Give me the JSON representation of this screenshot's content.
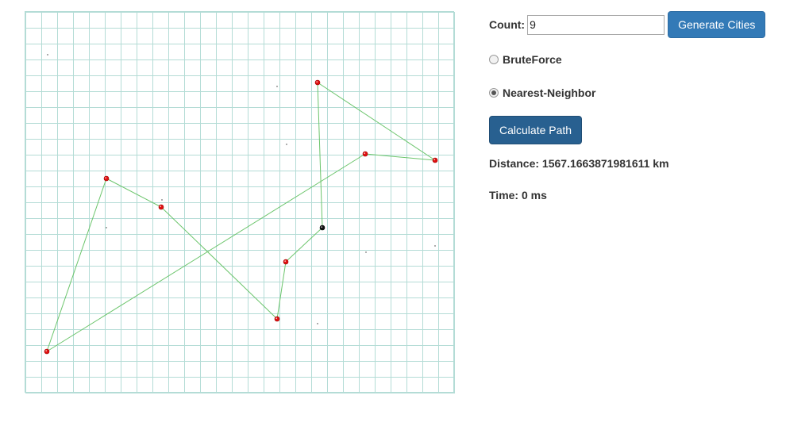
{
  "controls": {
    "count_label": "Count:",
    "count_value": "9",
    "generate_label": "Generate Cities",
    "algorithms": [
      {
        "label": "BruteForce",
        "selected": false
      },
      {
        "label": "Nearest-Neighbor",
        "selected": true
      }
    ],
    "calculate_label": "Calculate Path"
  },
  "results": {
    "distance_label": "Distance:",
    "distance_value": "1567.1663871981611",
    "distance_unit": "km",
    "time_label": "Time:",
    "time_value": "0",
    "time_unit": "ms"
  },
  "map": {
    "colors": {
      "grid": "#b4dcd6",
      "path": "#6cc56c",
      "city": "#e01010",
      "start_city": "#111111"
    },
    "cities": [
      {
        "id": "start",
        "start": true
      },
      {
        "id": "c1"
      },
      {
        "id": "c2"
      },
      {
        "id": "c3"
      },
      {
        "id": "c4"
      },
      {
        "id": "c5"
      },
      {
        "id": "c6"
      },
      {
        "id": "c7"
      },
      {
        "id": "c8"
      }
    ],
    "tour_order": [
      "start",
      "c1",
      "c2",
      "c3",
      "c4",
      "c5",
      "c6",
      "c7",
      "c8",
      "start"
    ]
  }
}
